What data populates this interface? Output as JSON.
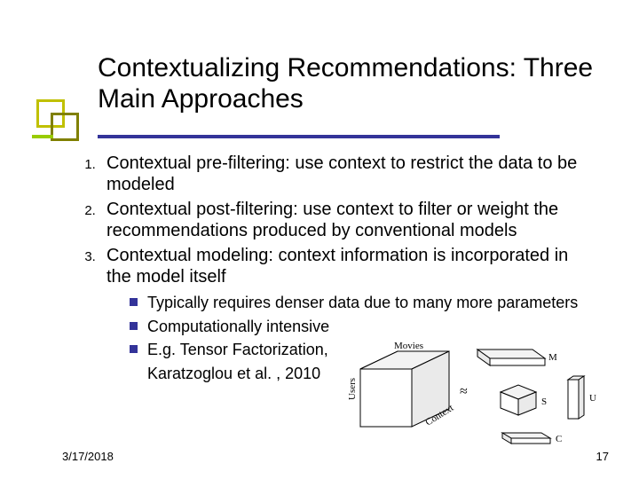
{
  "title": "Contextualizing Recommendations: Three Main Approaches",
  "items": [
    "Contextual pre-filtering: use context to restrict the data to be modeled",
    "Contextual post-filtering: use context to filter or weight the recommendations produced by conventional models",
    "Contextual modeling: context information is incorporated in the model itself"
  ],
  "subitems": [
    "Typically requires denser data due to many more parameters",
    "Computationally intensive",
    "E.g. Tensor Factorization,",
    "Karatzoglou et al. , 2010"
  ],
  "diagram": {
    "cube_y": "Users",
    "cube_top": "Movies",
    "cube_depth": "Context",
    "m": "M",
    "s": "S",
    "u": "U",
    "c": "C"
  },
  "footer": {
    "date": "3/17/2018",
    "page": "17"
  }
}
